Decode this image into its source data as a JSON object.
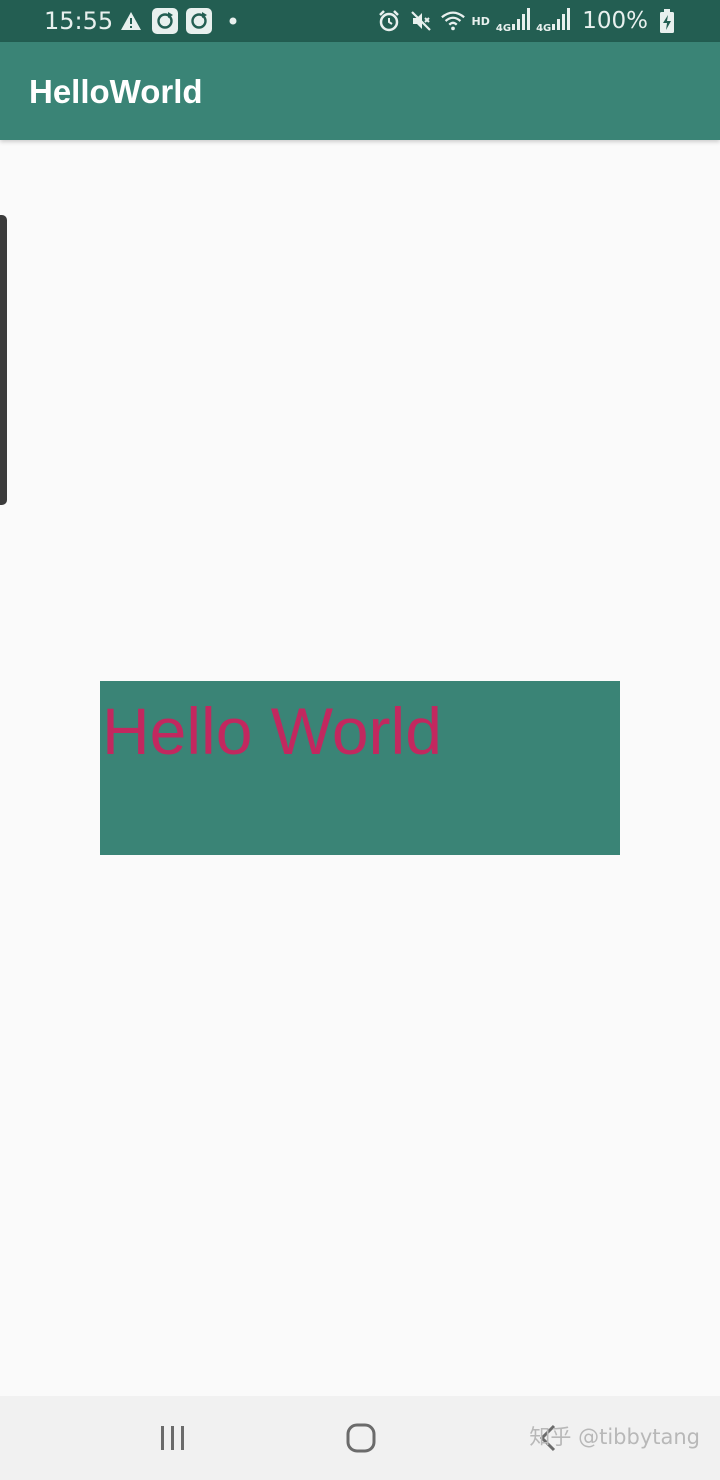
{
  "status_bar": {
    "time": "15:55",
    "network_label": "HD",
    "sim1_label": "4G",
    "sim2_label": "4G",
    "battery": "100%",
    "icons": [
      "warning-icon",
      "sync-icon",
      "sync-icon",
      "dot-icon",
      "alarm-icon",
      "mute-icon",
      "wifi-icon",
      "signal-icon",
      "signal-icon",
      "battery-charging-icon"
    ]
  },
  "app_bar": {
    "title": "HelloWorld"
  },
  "content": {
    "hello_text": "Hello World",
    "colors": {
      "box_background": "#3a8476",
      "text_color": "#c2285f"
    }
  },
  "nav_bar": {
    "icons": [
      "recents-icon",
      "home-icon",
      "back-icon"
    ],
    "watermark": "知乎 @tibbytang"
  },
  "colors": {
    "status_bar": "#235e52",
    "app_bar": "#3a8476",
    "background": "#fafafa"
  }
}
